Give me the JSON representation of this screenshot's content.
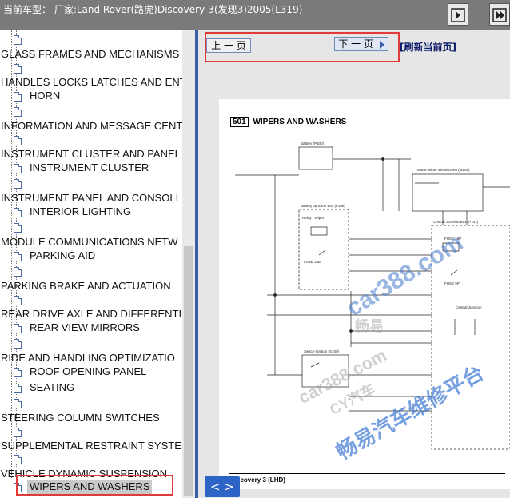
{
  "titlebar": {
    "title": "当前车型： 厂家:Land Rover(路虎)Discovery-3(发现3)2005(L319)",
    "buttons": [
      {
        "icon": "expand-left-icon"
      },
      {
        "icon": "expand-right-icon"
      }
    ]
  },
  "tree": {
    "items": [
      {
        "label": "GLASS FRAMES AND MECHANISMS",
        "level": 0
      },
      {
        "label": "HANDLES LOCKS LATCHES AND ENT",
        "level": 0
      },
      {
        "label": "HORN",
        "level": 1
      },
      {
        "label": "INFORMATION AND MESSAGE CENT",
        "level": 0
      },
      {
        "label": "INSTRUMENT CLUSTER AND PANEL",
        "level": 0
      },
      {
        "label": "INSTRUMENT CLUSTER",
        "level": 1
      },
      {
        "label": "INSTRUMENT PANEL AND CONSOLI",
        "level": 0
      },
      {
        "label": "INTERIOR LIGHTING",
        "level": 1
      },
      {
        "label": "MODULE COMMUNICATIONS NETW",
        "level": 0
      },
      {
        "label": "PARKING AID",
        "level": 1
      },
      {
        "label": "PARKING BRAKE AND ACTUATION",
        "level": 0
      },
      {
        "label": "REAR DRIVE AXLE AND DIFFERENTI",
        "level": 0
      },
      {
        "label": "REAR VIEW MIRRORS",
        "level": 1
      },
      {
        "label": "RIDE AND HANDLING OPTIMIZATIO",
        "level": 0
      },
      {
        "label": "ROOF OPENING PANEL",
        "level": 1
      },
      {
        "label": "SEATING",
        "level": 1
      },
      {
        "label": "STEERING COLUMN SWITCHES",
        "level": 0
      },
      {
        "label": "SUPPLEMENTAL RESTRAINT SYSTEM",
        "level": 0
      },
      {
        "label": "VEHICLE DYNAMIC SUSPENSION",
        "level": 0
      },
      {
        "label": "WIPERS AND WASHERS",
        "level": 1,
        "selected": true
      }
    ]
  },
  "viewer": {
    "prev_label": "上 一 页",
    "next_label": "下 一 页",
    "refresh_label": "[刷新当前页]",
    "diagram_code": "501",
    "diagram_title": "WIPERS AND WASHERS",
    "footer_caption": "Discovery 3 (LHD)",
    "toggle_label": "< >",
    "labels": {
      "battery": "Battery (P100)",
      "bjb": "Battery Junction Box (P108)",
      "cjb": "Central Junction Box (P101)",
      "wiper_motor": "Motor-Wiper-Windscreen (M105)",
      "switch": "Switch-Ignition (S100)",
      "fuse1": "FUSE 24E",
      "fuse2": "FUSE 18P",
      "fuse3": "FUSE 5P",
      "relay": "Relay - Wiper",
      "cjunc": "Central Junction"
    }
  },
  "watermarks": {
    "wm1": "car388.com",
    "wm2": "畅易",
    "wm3": "car388.com",
    "wm4": "CY汽车",
    "wm5": "畅易汽车维修平台"
  },
  "colors": {
    "accent": "#3b5fa8",
    "highlight": "#e23a3a",
    "titlebar": "#7a7a7a"
  }
}
